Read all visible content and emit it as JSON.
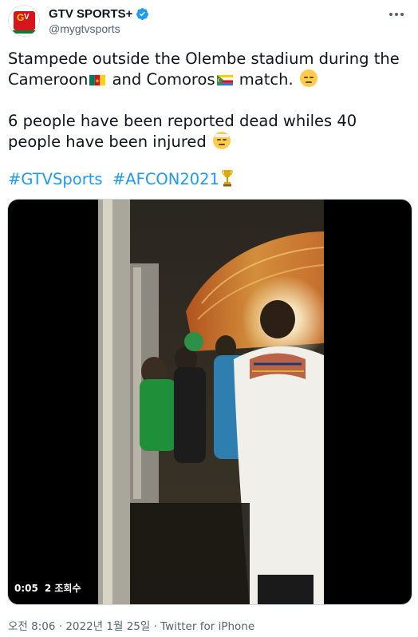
{
  "author": {
    "display_name": "GTV SPORTS+",
    "handle": "@mygtvsports",
    "avatar_label": "GTV",
    "verified": true
  },
  "tweet": {
    "line1_part1": "Stampede outside the Olembe stadium during the Cameroon",
    "line1_part2": " and Comoros",
    "line1_part3": " match.",
    "line2": "6 people have been reported dead whiles  40 people have been injured",
    "hashtags": [
      "#GTVSports",
      "#AFCON2021"
    ]
  },
  "video": {
    "elapsed": "0:05",
    "views": "2 조회수"
  },
  "footer": {
    "time": "오전 8:06",
    "separator": " · ",
    "date": "2022년 1월 25일",
    "source": "Twitter for iPhone"
  },
  "icons": {
    "more": "more-dots-icon",
    "verified": "verified-badge-icon",
    "flag1": "cameroon-flag-icon",
    "flag2": "comoros-flag-icon",
    "trophy": "trophy-icon"
  },
  "colors": {
    "link": "#1d9bf0",
    "verified": "#1d9bf0",
    "secondary_text": "#536471"
  }
}
